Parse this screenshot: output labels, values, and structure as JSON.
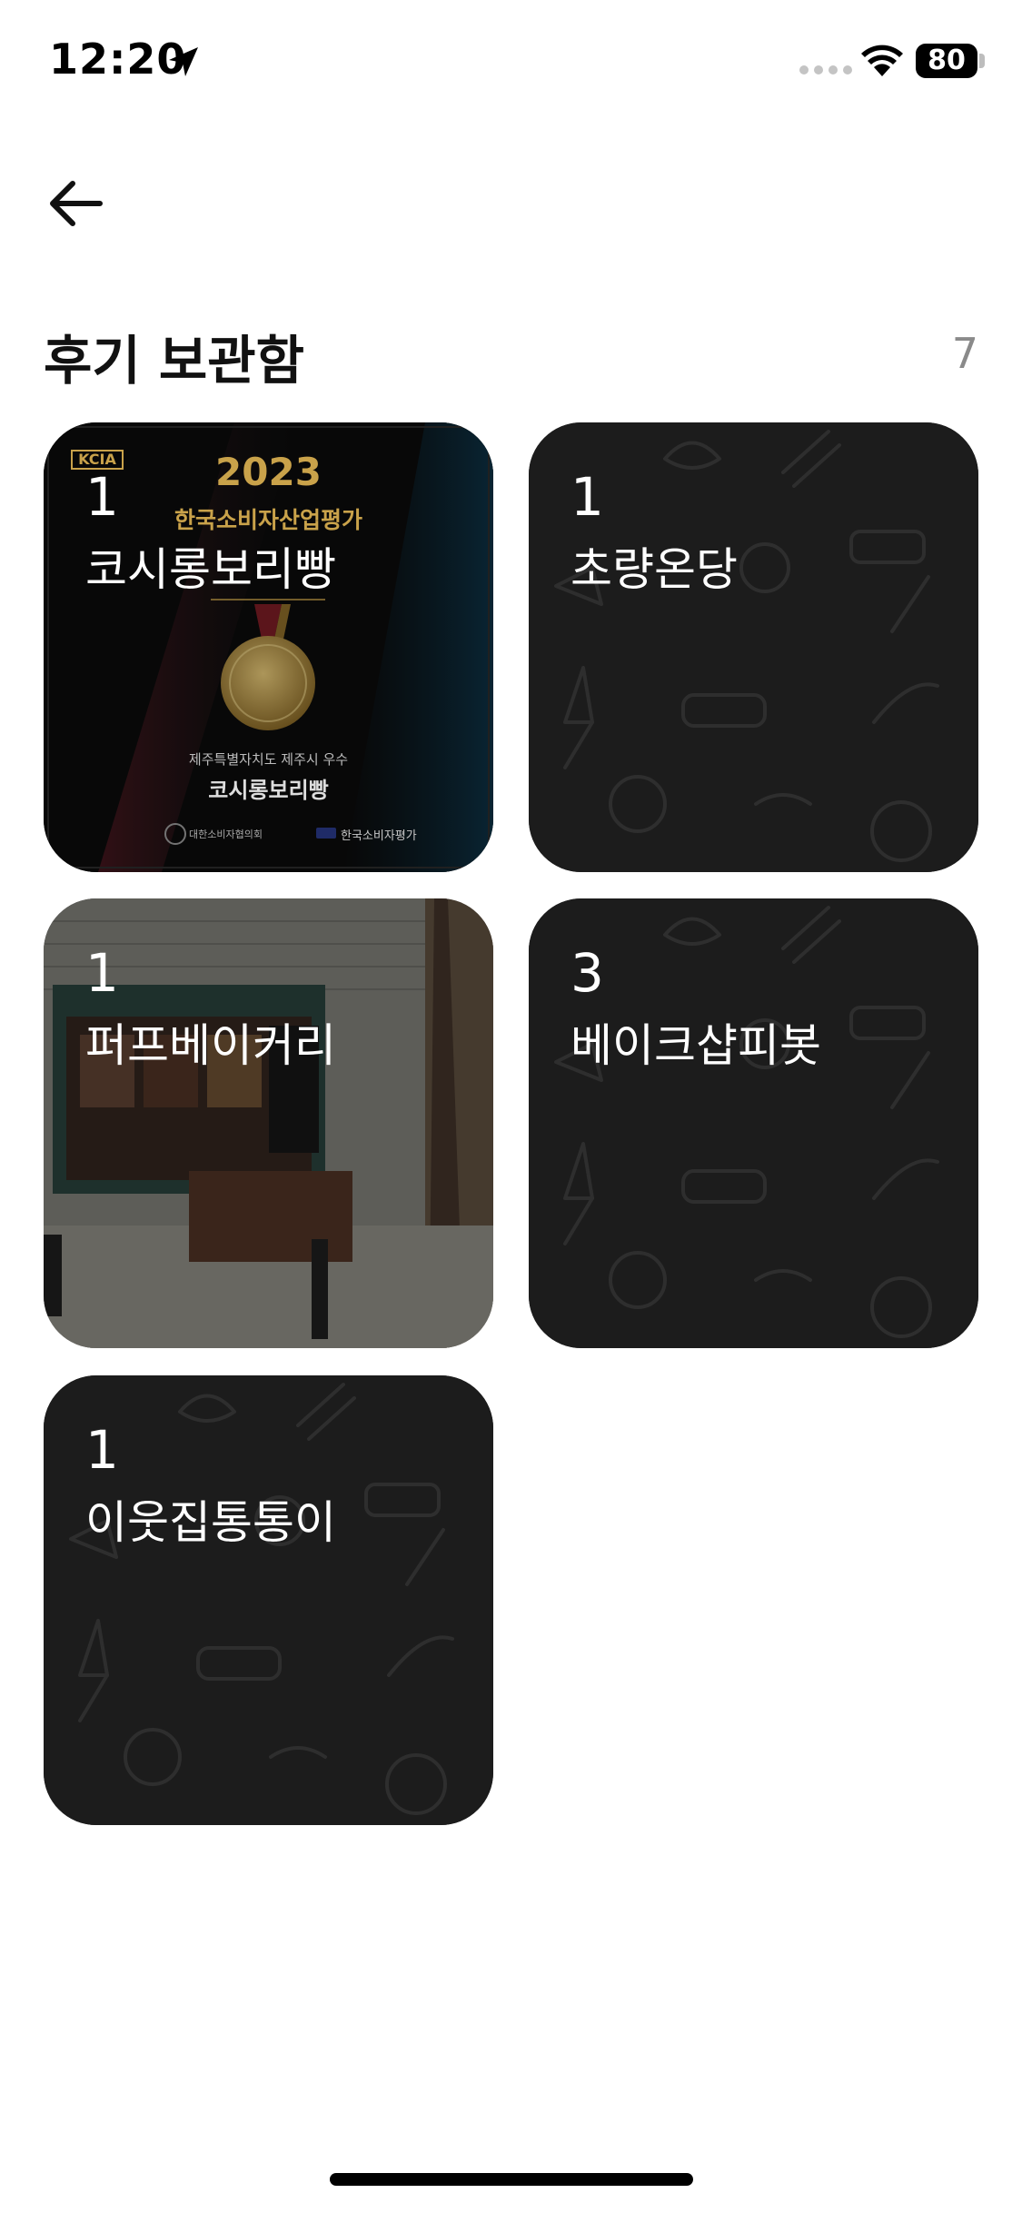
{
  "status_bar": {
    "time": "12:20",
    "battery": "80"
  },
  "header": {
    "title": "후기 보관함",
    "count": "7"
  },
  "cards": [
    {
      "count": "1",
      "name": "코시롱보리빵",
      "background": "photo-award"
    },
    {
      "count": "1",
      "name": "초량온당",
      "background": "pattern"
    },
    {
      "count": "1",
      "name": "퍼프베이커리",
      "background": "photo-storefront"
    },
    {
      "count": "3",
      "name": "베이크샵피봇",
      "background": "pattern"
    },
    {
      "count": "1",
      "name": "이웃집통통이",
      "background": "pattern"
    }
  ],
  "award_image": {
    "logo": "KCIA",
    "year": "2023",
    "headline": "한국소비자산업평가",
    "region": "제주특별자치도 제주시 우수",
    "winner": "코시롱보리빵",
    "host": "대한소비자협의회",
    "organizer": "한국소비자평가"
  },
  "colors": {
    "card_dark": "#1c1c1c",
    "pattern_line": "#2e2e2e",
    "count_gray": "#8a8a8a",
    "award_gold": "#c9a24a"
  }
}
